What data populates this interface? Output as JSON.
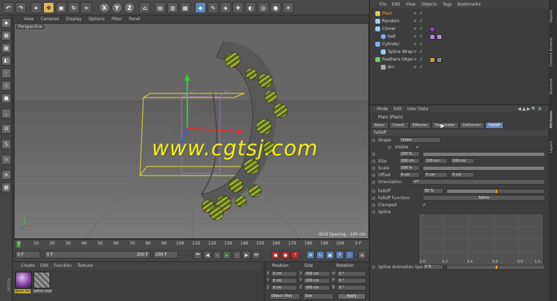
{
  "watermark": "www.cgtsj.com",
  "viewport": {
    "menu": [
      "View",
      "Cameras",
      "Display",
      "Options",
      "Filter",
      "Panel"
    ],
    "label": "Perspective",
    "grid_spacing": "Grid Spacing : 100 cm"
  },
  "toolbar": {
    "axis_letters": [
      "X",
      "Y",
      "Z"
    ]
  },
  "timeline": {
    "ticks": [
      "0",
      "10",
      "20",
      "30",
      "40",
      "50",
      "60",
      "70",
      "80",
      "90",
      "100",
      "110",
      "120",
      "130",
      "140",
      "150",
      "160",
      "170",
      "180",
      "190",
      "200"
    ],
    "end_label": "0 F",
    "start_field": "0 F",
    "current_field": "0 F",
    "end_field": "200 F",
    "max_field": "200 F"
  },
  "materials": {
    "menu": [
      "Create",
      "Edit",
      "Function",
      "Texture"
    ],
    "items": [
      {
        "name": "glass ba"
      },
      {
        "name": "spline mat"
      }
    ]
  },
  "coordinates": {
    "headers": [
      "Position",
      "Size",
      "Rotation"
    ],
    "axes": [
      "X",
      "Y",
      "Z"
    ],
    "position": [
      "0 cm",
      "0 cm",
      "0 cm"
    ],
    "size": [
      "200 cm",
      "200 cm",
      "200 cm"
    ],
    "rot_axes": [
      "H",
      "P",
      "B"
    ],
    "rotation": [
      "0 °",
      "0 °",
      "0 °"
    ],
    "mode_select": "Object (Rel)",
    "size_select": "Size",
    "apply": "Apply"
  },
  "object_manager": {
    "menu": [
      "File",
      "Edit",
      "View",
      "Objects",
      "Tags",
      "Bookmarks"
    ],
    "objects": [
      {
        "name": "Plain",
        "selected": true,
        "color": "#d8d040"
      },
      {
        "name": "Random",
        "selected": false,
        "color": "#9ad0f0"
      },
      {
        "name": "Cloner",
        "selected": false,
        "color": "#9ad0f0"
      },
      {
        "name": "ball",
        "selected": false,
        "color": "#7ab0f0"
      },
      {
        "name": "Cylinder",
        "selected": false,
        "color": "#7ab0f0"
      },
      {
        "name": "Spline Wrap",
        "selected": false,
        "color": "#9ad0f0"
      },
      {
        "name": "Feathers Object",
        "selected": false,
        "color": "#6fd06f"
      },
      {
        "name": "Arc",
        "selected": false,
        "color": "#aaa"
      }
    ]
  },
  "attribute_manager": {
    "menu": [
      "Mode",
      "Edit",
      "User Data"
    ],
    "title": "Plain [Plain]",
    "tabs": [
      "Basic",
      "Coord.",
      "Effector",
      "Parameter",
      "Deformer",
      "Falloff"
    ],
    "active_tab": "Falloff",
    "section": "Falloff",
    "shape_label": "Shape",
    "shape_value": "Linear",
    "visible_label": "Visible",
    "visible_value": "✓",
    "weight_value": "100 %",
    "size_label": "Size",
    "size_values": [
      "100 cm",
      "100 cm",
      "100 cm"
    ],
    "scale_label": "Scale",
    "scale_value": "100 %",
    "offset_label": "Offset",
    "offset_values": [
      "0 cm",
      "0 cm",
      "0 cm"
    ],
    "orientation_label": "Orientation",
    "orientation_value": "+Y",
    "falloff_label": "Falloff",
    "falloff_value": "50 %",
    "falloff_level": 0.5,
    "falloff_function_label": "Falloff Function",
    "falloff_function_value": "Spline",
    "clamped_label": "Clamped",
    "clamped_value": "✓",
    "spline_label": "Spline",
    "graph_x": [
      "0.0",
      "0.2",
      "0.4",
      "0.6",
      "0.8",
      "1.0"
    ],
    "spline_speed_label": "Spline Animation Speed",
    "spline_speed_value": "0 %"
  },
  "side_tabs": [
    "Objects",
    "Content Browser",
    "Structure",
    "Attributes",
    "Layers"
  ]
}
